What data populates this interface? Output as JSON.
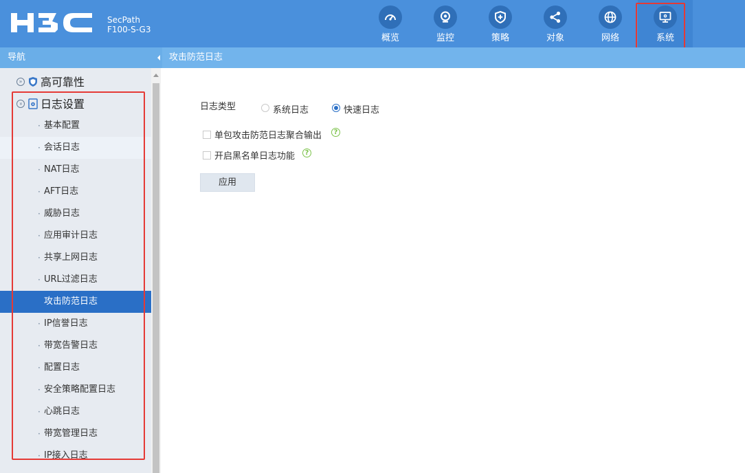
{
  "header": {
    "logo_text": "H3C",
    "product_line1": "SecPath",
    "product_line2": "F100-S-G3",
    "nav": [
      {
        "label": "概览",
        "icon": "gauge-icon"
      },
      {
        "label": "监控",
        "icon": "camera-icon"
      },
      {
        "label": "策略",
        "icon": "shield-plus-icon"
      },
      {
        "label": "对象",
        "icon": "share-icon"
      },
      {
        "label": "网络",
        "icon": "globe-icon"
      },
      {
        "label": "系统",
        "icon": "monitor-gear-icon",
        "active": true
      }
    ]
  },
  "sidebar": {
    "title": "导航",
    "groups": [
      {
        "label": "高可靠性",
        "icon": "shield-icon",
        "expanded": false
      },
      {
        "label": "日志设置",
        "icon": "doc-gear-icon",
        "expanded": true
      }
    ],
    "items": [
      {
        "label": "基本配置"
      },
      {
        "label": "会话日志"
      },
      {
        "label": "NAT日志"
      },
      {
        "label": "AFT日志"
      },
      {
        "label": "威胁日志"
      },
      {
        "label": "应用审计日志"
      },
      {
        "label": "共享上网日志"
      },
      {
        "label": "URL过滤日志"
      },
      {
        "label": "攻击防范日志",
        "selected": true
      },
      {
        "label": "IP信誉日志"
      },
      {
        "label": "带宽告警日志"
      },
      {
        "label": "配置日志"
      },
      {
        "label": "安全策略配置日志"
      },
      {
        "label": "心跳日志"
      },
      {
        "label": "带宽管理日志"
      },
      {
        "label": "IP接入日志"
      }
    ]
  },
  "main": {
    "title": "攻击防范日志",
    "log_type_label": "日志类型",
    "options": [
      {
        "label": "系统日志",
        "checked": false
      },
      {
        "label": "快速日志",
        "checked": true
      }
    ],
    "checkboxes": [
      {
        "label": "单包攻击防范日志聚合输出",
        "checked": false
      },
      {
        "label": "开启黑名单日志功能",
        "checked": false
      }
    ],
    "apply_label": "应用"
  },
  "colors": {
    "header_bg": "#4a90dc",
    "selected_bg": "#2a6fc6",
    "highlight_border": "#e53935",
    "help_green": "#7cc24a"
  }
}
